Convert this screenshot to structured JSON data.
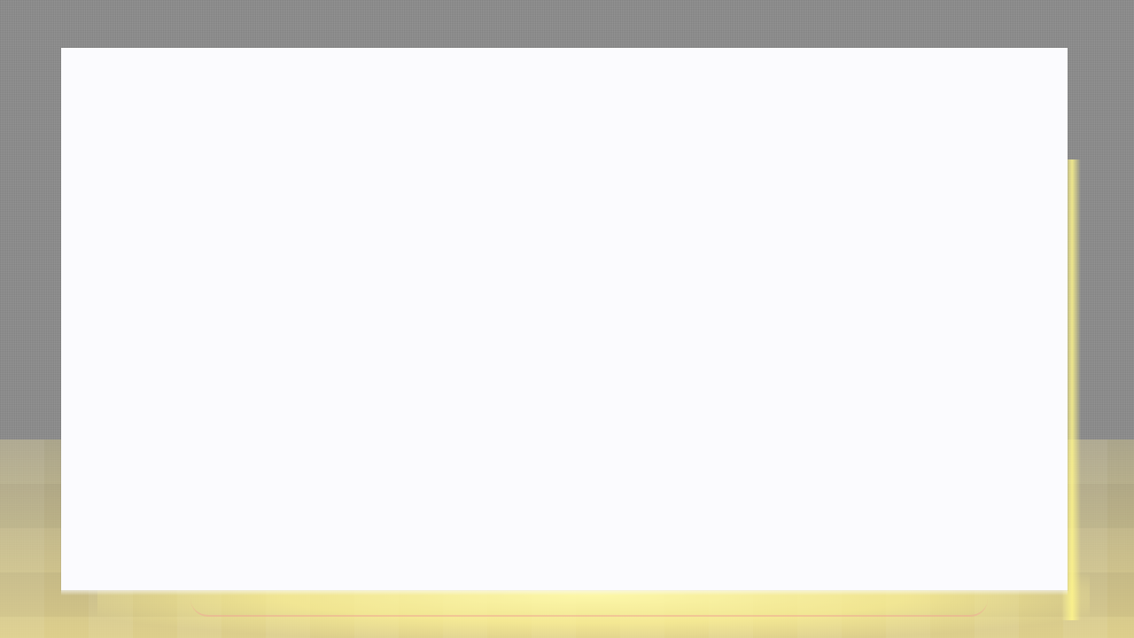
{
  "screen": {
    "background_color": "#8c8c8c",
    "panel_color": "#fbfbfe",
    "glow_color": "#fff4a0",
    "content": ""
  }
}
